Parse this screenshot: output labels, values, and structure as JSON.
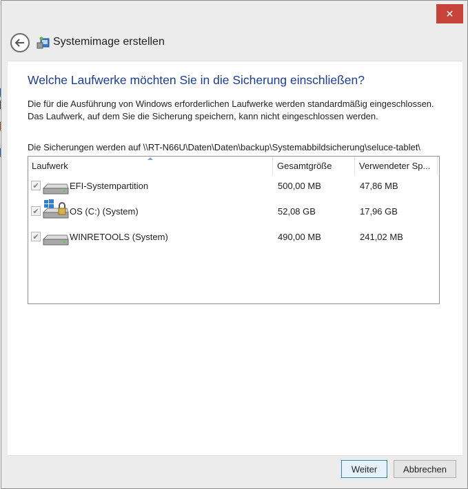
{
  "window": {
    "title": "Systemimage erstellen",
    "close_label": "✕",
    "colors": {
      "accent_heading": "#1a3d94",
      "close": "#c7443a"
    }
  },
  "content": {
    "heading": "Welche Laufwerke möchten Sie in die Sicherung einschließen?",
    "description": "Die für die Ausführung von Windows erforderlichen Laufwerke werden standardmäßig eingeschlossen. Das Laufwerk, auf dem Sie die Sicherung speichern, kann nicht eingeschlossen werden.",
    "destination": "Die Sicherungen werden auf \\\\RT-N66U\\Daten\\Daten\\backup\\Systemabbildsicherung\\seluce-tablet\\"
  },
  "drive_list": {
    "columns": [
      "Laufwerk",
      "Gesamtgröße",
      "Verwendeter Sp..."
    ],
    "rows": [
      {
        "name": "EFI-Systempartition",
        "total": "500,00 MB",
        "used": "47,86 MB",
        "checked": true,
        "icon": "hard-drive-icon"
      },
      {
        "name": "OS (C:) (System)",
        "total": "52,08 GB",
        "used": "17,96 GB",
        "checked": true,
        "icon": "windows-drive-icon"
      },
      {
        "name": "WINRETOOLS (System)",
        "total": "490,00 MB",
        "used": "241,02 MB",
        "checked": true,
        "icon": "hard-drive-icon"
      }
    ]
  },
  "footer": {
    "next_label": "Weiter",
    "cancel_label": "Abbrechen"
  }
}
